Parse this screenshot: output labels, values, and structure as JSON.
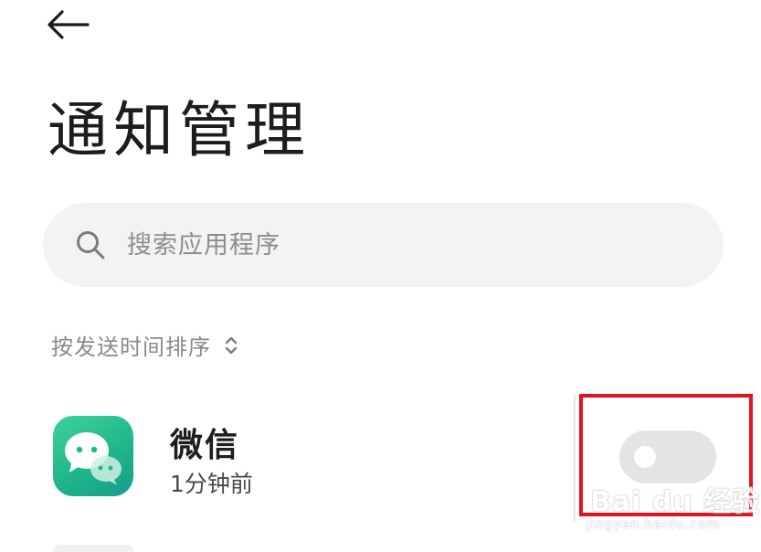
{
  "header": {
    "back_icon": "arrow-left-icon",
    "title": "通知管理"
  },
  "search": {
    "icon": "search-icon",
    "placeholder": "搜索应用程序",
    "value": ""
  },
  "sort": {
    "label": "按发送时间排序",
    "icon": "chevron-up-down-icon"
  },
  "apps": [
    {
      "name": "微信",
      "time": "1分钟前",
      "icon": "wechat-icon",
      "notifications_enabled": false
    }
  ],
  "annotation": {
    "color": "#e0141f"
  },
  "watermark": {
    "text": "Bai du 经验",
    "subtext": "jingyan.baidu.com"
  },
  "colors": {
    "app_icon_green": "#21b68a",
    "toggle_off": "#e4e4e4"
  }
}
